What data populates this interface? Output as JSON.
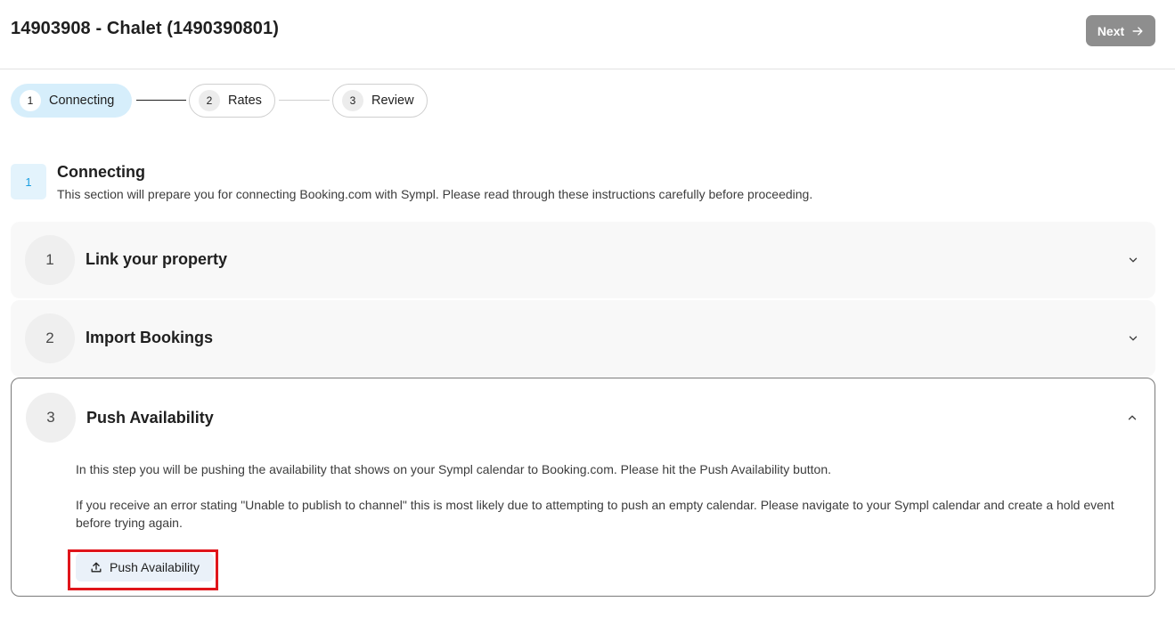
{
  "header": {
    "title": "14903908 - Chalet (1490390801)",
    "next_label": "Next"
  },
  "stepper": {
    "steps": [
      {
        "number": "1",
        "label": "Connecting",
        "state": "active"
      },
      {
        "number": "2",
        "label": "Rates",
        "state": "inactive"
      },
      {
        "number": "3",
        "label": "Review",
        "state": "inactive"
      }
    ]
  },
  "section": {
    "number": "1",
    "title": "Connecting",
    "description": "This section will prepare you for connecting Booking.com with Sympl. Please read through these instructions carefully before proceeding."
  },
  "accordion": [
    {
      "number": "1",
      "title": "Link your property",
      "expanded": false
    },
    {
      "number": "2",
      "title": "Import Bookings",
      "expanded": false
    },
    {
      "number": "3",
      "title": "Push Availability",
      "expanded": true,
      "paragraph1": "In this step you will be pushing the availability that shows on your Sympl calendar to Booking.com. Please hit the Push Availability button.",
      "paragraph2": "If you receive an error stating \"Unable to publish to channel\" this is most likely due to attempting to push an empty calendar. Please navigate to your Sympl calendar and create a hold event before trying again.",
      "button_label": "Push Availability"
    }
  ],
  "colors": {
    "active_step_bg": "#d6eefb",
    "badge_text": "#1a9ee0",
    "next_button_bg": "#8e8e8e",
    "push_button_bg": "#eaf1f9",
    "highlight_border": "#e0151b"
  },
  "icons": {
    "next": "arrow-right-icon",
    "collapsed_chevron": "chevron-down-icon",
    "expanded_chevron": "chevron-up-icon",
    "push": "upload-icon"
  }
}
